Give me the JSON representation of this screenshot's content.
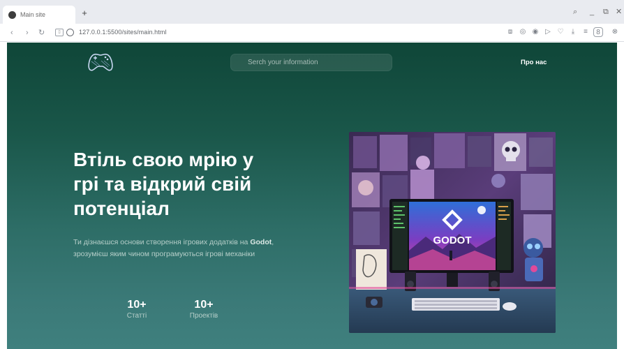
{
  "browser": {
    "tab_title": "Main site",
    "new_tab": "+",
    "url": "127.0.0.1:5500/sites/main.html",
    "controls": {
      "search": "⌕",
      "minimize": "_",
      "restore": "⧉",
      "close": "✕"
    }
  },
  "header": {
    "logo": "gamepad-logo",
    "search_placeholder": "Serch your information",
    "nav_about": "Про нас"
  },
  "hero": {
    "title": "Втіль свою мрію у грі та відкрий свій потенціал",
    "desc_before": "Ти дізнаєшся основи створення ігрових додатків на ",
    "desc_bold": "Godot",
    "desc_after": ", зрозумієш яким чином програмуються ігрові механіки",
    "image_text": "GODOT"
  },
  "stats": [
    {
      "value": "10+",
      "label": "Статті"
    },
    {
      "value": "10+",
      "label": "Проектів"
    }
  ],
  "colors": {
    "bg_top": "#0f4638",
    "bg_bottom": "#3f807e",
    "text": "#ffffff",
    "muted": "#b7cfca"
  }
}
